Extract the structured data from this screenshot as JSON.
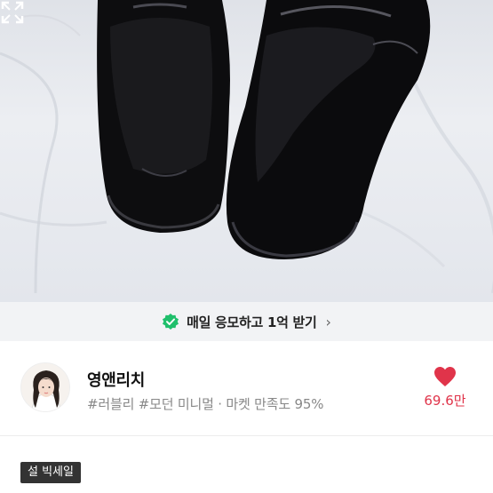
{
  "promo": {
    "text": "매일 응모하고 1억 받기",
    "chevron": "›",
    "check_icon": "check-badge-icon",
    "accent": "#1fbf6b"
  },
  "store": {
    "name": "영앤리치",
    "tags": "#러블리 #모던 미니멀 · 마켓 만족도 95%",
    "like_count": "69.6만",
    "heart_color": "#e0344a"
  },
  "badge": {
    "label": "설 빅세일"
  }
}
